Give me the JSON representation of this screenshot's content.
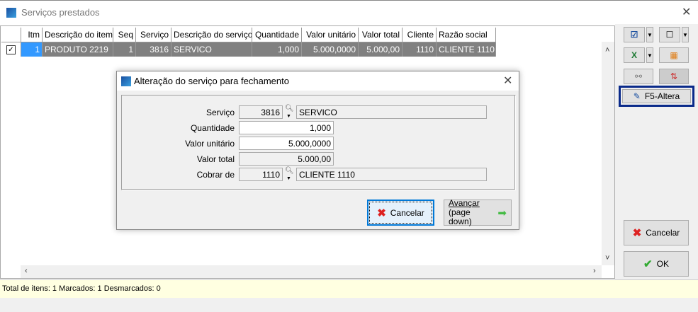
{
  "window": {
    "title": "Serviços prestados",
    "close_icon": "close-icon"
  },
  "grid": {
    "columns": [
      "Itm",
      "Descrição do item",
      "Seq",
      "Serviço",
      "Descrição do serviço",
      "Quantidade",
      "Valor unitário",
      "Valor total",
      "Cliente",
      "Razão social"
    ],
    "rows": [
      {
        "checked": true,
        "cells": [
          "1",
          "PRODUTO 2219",
          "1",
          "3816",
          "SERVICO",
          "1,000",
          "5.000,0000",
          "5.000,00",
          "1110",
          "CLIENTE 1110"
        ]
      }
    ]
  },
  "right_panel": {
    "f5_label": "F5-Altera",
    "cancel_label": "Cancelar",
    "ok_label": "OK"
  },
  "status": "Total de itens: 1 Marcados: 1 Desmarcados: 0",
  "dialog": {
    "title": "Alteração do serviço para fechamento",
    "fields": {
      "servico": {
        "label": "Serviço",
        "code": "3816",
        "desc": "SERVICO"
      },
      "quantidade": {
        "label": "Quantidade",
        "value": "1,000"
      },
      "valor_unitario": {
        "label": "Valor unitário",
        "value": "5.000,0000"
      },
      "valor_total": {
        "label": "Valor total",
        "value": "5.000,00"
      },
      "cobrar_de": {
        "label": "Cobrar de",
        "code": "1110",
        "desc": "CLIENTE 1110"
      }
    },
    "cancel_label": "Cancelar",
    "next_label_1": "Avançar",
    "next_label_2": "(page down)"
  },
  "colors": {
    "accent": "#0a2a8a",
    "selected": "#808080",
    "status_bg": "#ffffe1"
  }
}
